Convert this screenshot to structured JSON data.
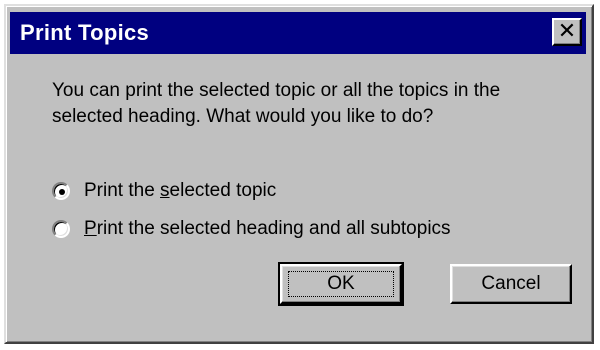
{
  "window": {
    "title": "Print Topics",
    "close_glyph": "✕"
  },
  "message": "You can print the selected topic or all the topics in the selected heading. What would you like to do?",
  "options": [
    {
      "pre": "Print the ",
      "mnemonic": "s",
      "post": "elected topic",
      "checked": true
    },
    {
      "pre": "",
      "mnemonic": "P",
      "post": "rint the selected heading and all subtopics",
      "checked": false
    }
  ],
  "buttons": {
    "ok_label": "OK",
    "cancel_label": "Cancel"
  },
  "colors": {
    "titlebar": "#000080",
    "dialog_face": "#c0c0c0"
  }
}
